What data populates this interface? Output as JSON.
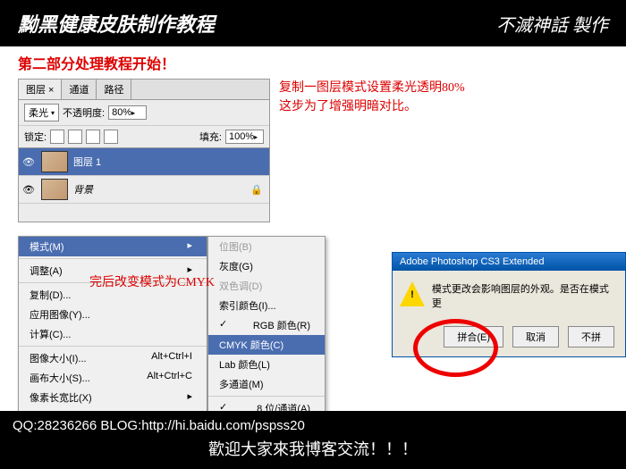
{
  "header": {
    "title": "黝黑健康皮肤制作教程",
    "logo": "不滅神話 製作"
  },
  "subtitle": "第二部分处理教程开始！",
  "layers": {
    "tabs": [
      "图层 ×",
      "通道",
      "路径"
    ],
    "blend_mode": "柔光",
    "opacity_label": "不透明度:",
    "opacity_value": "80%",
    "lock_label": "锁定:",
    "fill_label": "填充:",
    "fill_value": "100%",
    "layer1": "图层 1",
    "bg_layer": "背景"
  },
  "desc": {
    "l1": "复制一图层模式设置柔光透明80%",
    "l2": "这步为了增强明暗对比。"
  },
  "menu1": {
    "mode": "模式(M)",
    "adjust": "调整(A)",
    "dup": "复制(D)...",
    "apply": "应用图像(Y)...",
    "calc": "计算(C)...",
    "imgsize": "图像大小(I)...",
    "imgsize_sc": "Alt+Ctrl+I",
    "canvas": "画布大小(S)...",
    "canvas_sc": "Alt+Ctrl+C",
    "pixel": "像素长宽比(X)"
  },
  "menu2": {
    "bitmap": "位图(B)",
    "gray": "灰度(G)",
    "duo": "双色调(D)",
    "indexed": "索引颜色(I)...",
    "rgb": "RGB 颜色(R)",
    "cmyk": "CMYK 颜色(C)",
    "lab": "Lab 颜色(L)",
    "multi": "多通道(M)",
    "bits8": "8 位/通道(A)"
  },
  "note2": "完后改变模式为CMYK",
  "dialog": {
    "title": "Adobe Photoshop CS3 Extended",
    "msg": "模式更改会影响图层的外观。是否在模式更",
    "btn_flatten": "拼合(E)",
    "btn_cancel": "取消",
    "btn_no": "不拼"
  },
  "footer": {
    "line1": "QQ:28236266  BLOG:http://hi.baidu.com/pspss20",
    "line2": "歡迎大家來我博客交流！！！"
  }
}
